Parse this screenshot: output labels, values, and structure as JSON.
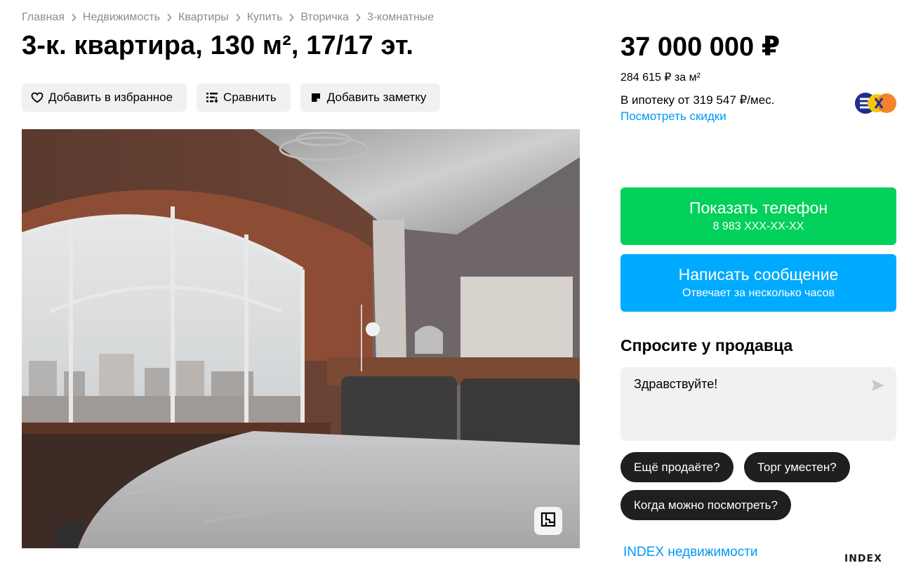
{
  "breadcrumbs": [
    "Главная",
    "Недвижимость",
    "Квартиры",
    "Купить",
    "Вторичка",
    "3-комнатные"
  ],
  "listing": {
    "title": "3-к. квартира, 130 м², 17/17 эт."
  },
  "actions": {
    "favorite": "Добавить в избранное",
    "compare": "Сравнить",
    "note": "Добавить заметку"
  },
  "gallery": {
    "photo_icon": "floor-plan-icon"
  },
  "pricing": {
    "price": "37 000 000 ₽",
    "price_per_m2": "284 615 ₽ за м²",
    "mortgage": "В ипотеку от 319 547 ₽/мес.",
    "discounts_link": "Посмотреть скидки"
  },
  "contact": {
    "phone_label": "Показать телефон",
    "phone_masked": "8 983 XXX-XX-XX",
    "message_label": "Написать сообщение",
    "message_sub": "Отвечает за несколько часов"
  },
  "ask": {
    "title": "Спросите у продавца",
    "input_value": "Здравствуйте!",
    "chips": [
      "Ещё продаёте?",
      "Торг уместен?",
      "Когда можно посмотреть?"
    ]
  },
  "seller": {
    "agency_name": "INDEX недвижимости",
    "agency_logo_text": "INDEX"
  },
  "colors": {
    "phone_button": "#02d15c",
    "message_button": "#00aaff",
    "link": "#0099f7",
    "chip": "#1f1f1f"
  }
}
